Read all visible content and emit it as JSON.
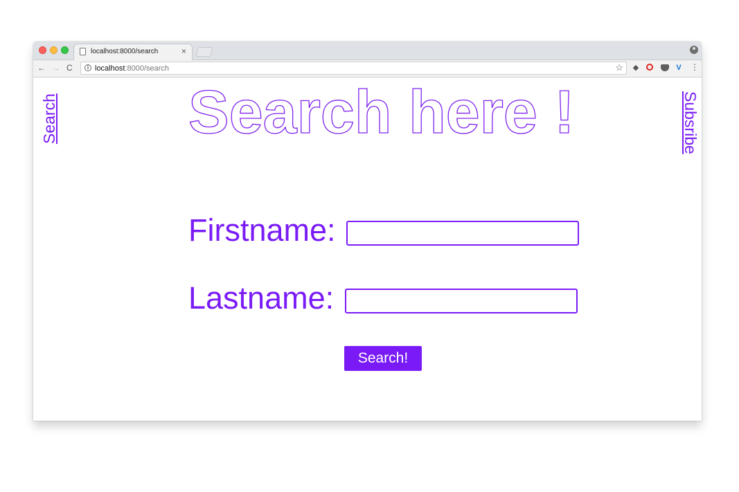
{
  "browser": {
    "tab_title": "localhost:8000/search",
    "tab_close": "×",
    "url_host": "localhost",
    "url_path": ":8000/search",
    "nav": {
      "back": "←",
      "forward": "→",
      "reload": "C"
    },
    "icons": [
      "document-icon",
      "close-icon",
      "profile-icon",
      "info-icon",
      "star-icon",
      "extension-icon",
      "opera-icon",
      "pocket-icon",
      "vivaldi-icon",
      "menu-icon"
    ],
    "star": "☆",
    "menu": "⋮",
    "info": "i"
  },
  "page": {
    "heading": "Search here !",
    "nav_left": "Search",
    "nav_right": "Subsribe",
    "form": {
      "firstname_label": "Firstname:",
      "firstname_value": "",
      "lastname_label": "Lastname:",
      "lastname_value": "",
      "submit_label": "Search!"
    }
  },
  "colors": {
    "accent": "#7a1bf7",
    "chrome_bar": "#dee1e6",
    "toolbar": "#f2f2f2"
  }
}
